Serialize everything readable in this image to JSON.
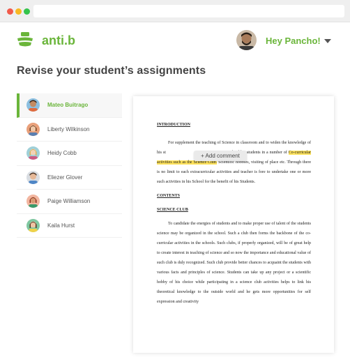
{
  "app": {
    "brand": "anti.b",
    "greeting": "Hey Pancho!"
  },
  "page": {
    "title": "Revise your student’s assignments"
  },
  "students": [
    {
      "name": "Mateo Buitrago",
      "active": true
    },
    {
      "name": "Liberty Wilkinson",
      "active": false
    },
    {
      "name": "Heidy Cobb",
      "active": false
    },
    {
      "name": "Eliezer Glover",
      "active": false
    },
    {
      "name": "Paige Williamson",
      "active": false
    },
    {
      "name": "Kaila Hurst",
      "active": false
    }
  ],
  "comment": {
    "add_label": "+ Add comment"
  },
  "document": {
    "heading_intro": "INTRODUCTION",
    "intro_p1_a": "For supplement the teaching of Science in classroom and to widen the knowledge of his st",
    "intro_p1_b": "r can in involved his students in a number of",
    "intro_highlight": "Co-curricular activities such as the Science Club.",
    "intro_p1_c": "Scientific hobbies, visiting of place etc. Through there is no limit to each extracurricular activities and teacher is fore to undertake one or more such activities in his School for the benefit of his Students.",
    "heading_contents": "CONTENTS",
    "heading_science": "SCIENCE CLUB",
    "science_p1": "To candidate the energies of students and to make proper use of talent of the students science may be organized in the school.  Such a club then forms the backbone of the co-curricular activities in the schools.   Such clubs, if properly organized, will be of great help to create interest in teaching of science and so now the importance and educational value of such club is duly recognized.  Such club provide better chances to acquaint the students with various facts and principles of science.  Students can take up any project or a scientific hobby of his choice while participating  in a science club activities helps to link his theoretical knowledge to the outside world and he gets more opportunities for self expression and creativity"
  },
  "colors": {
    "accent": "#6ab53a",
    "highlight": "#ffe35c"
  }
}
